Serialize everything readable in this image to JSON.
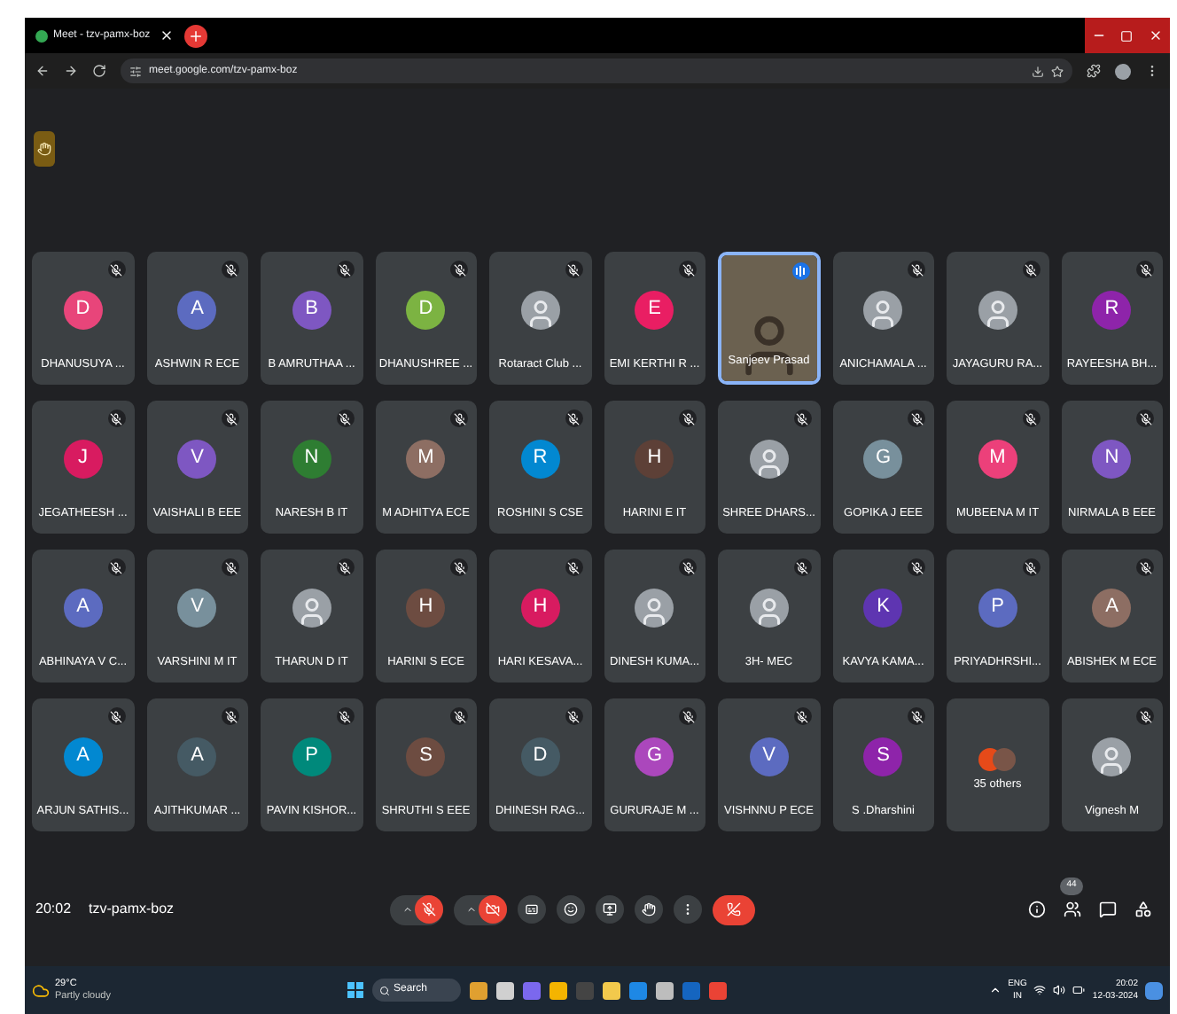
{
  "browser": {
    "tab_title": "Meet - tzv-pamx-boz",
    "url": "meet.google.com/tzv-pamx-boz"
  },
  "participants": [
    {
      "kind": "letter",
      "initial": "D",
      "color": "#e8457a",
      "name": "DHANUSUYA ...",
      "muted": true,
      "speaking": false
    },
    {
      "kind": "letter",
      "initial": "A",
      "color": "#5c6bc0",
      "name": "ASHWIN R ECE",
      "muted": true,
      "speaking": false
    },
    {
      "kind": "letter",
      "initial": "B",
      "color": "#7e57c2",
      "name": "B AMRUTHAA ...",
      "muted": true,
      "speaking": false
    },
    {
      "kind": "letter",
      "initial": "D",
      "color": "#7cb342",
      "name": "DHANUSHREE ...",
      "muted": true,
      "speaking": false
    },
    {
      "kind": "image",
      "name": "Rotaract Club ...",
      "muted": true,
      "speaking": false
    },
    {
      "kind": "letter",
      "initial": "E",
      "color": "#e91e63",
      "name": "EMI KERTHI R ...",
      "muted": true,
      "speaking": false
    },
    {
      "kind": "video",
      "name": "Sanjeev Prasad",
      "muted": false,
      "speaking": true
    },
    {
      "kind": "image",
      "name": "ANICHAMALA ...",
      "muted": true,
      "speaking": false
    },
    {
      "kind": "image",
      "name": "JAYAGURU RA...",
      "muted": true,
      "speaking": false
    },
    {
      "kind": "letter",
      "initial": "R",
      "color": "#8e24aa",
      "name": "RAYEESHA BH...",
      "muted": true,
      "speaking": false
    },
    {
      "kind": "letter",
      "initial": "J",
      "color": "#d81b60",
      "name": "JEGATHEESH ...",
      "muted": true,
      "speaking": false
    },
    {
      "kind": "letter",
      "initial": "V",
      "color": "#7e57c2",
      "name": "VAISHALI B EEE",
      "muted": true,
      "speaking": false
    },
    {
      "kind": "letter",
      "initial": "N",
      "color": "#2e7d32",
      "name": "NARESH B IT",
      "muted": true,
      "speaking": false
    },
    {
      "kind": "letter",
      "initial": "M",
      "color": "#8d6e63",
      "name": "M ADHITYA ECE",
      "muted": true,
      "speaking": false
    },
    {
      "kind": "letter",
      "initial": "R",
      "color": "#0288d1",
      "name": "ROSHINI S CSE",
      "muted": true,
      "speaking": false
    },
    {
      "kind": "letter",
      "initial": "H",
      "color": "#5d4037",
      "name": "HARINI E IT",
      "muted": true,
      "speaking": false
    },
    {
      "kind": "image",
      "name": "SHREE DHARS...",
      "muted": true,
      "speaking": false
    },
    {
      "kind": "letter",
      "initial": "G",
      "color": "#78909c",
      "name": "GOPIKA J EEE",
      "muted": true,
      "speaking": false
    },
    {
      "kind": "letter",
      "initial": "M",
      "color": "#ec407a",
      "name": "MUBEENA M IT",
      "muted": true,
      "speaking": false
    },
    {
      "kind": "letter",
      "initial": "N",
      "color": "#7e57c2",
      "name": "NIRMALA B EEE",
      "muted": true,
      "speaking": false
    },
    {
      "kind": "letter",
      "initial": "A",
      "color": "#5c6bc0",
      "name": "ABHINAYA V C...",
      "muted": true,
      "speaking": false
    },
    {
      "kind": "letter",
      "initial": "V",
      "color": "#78909c",
      "name": "VARSHINI M IT",
      "muted": true,
      "speaking": false
    },
    {
      "kind": "image",
      "name": "THARUN D IT",
      "muted": true,
      "speaking": false
    },
    {
      "kind": "letter",
      "initial": "H",
      "color": "#6d4c41",
      "name": "HARINI S ECE",
      "muted": true,
      "speaking": false
    },
    {
      "kind": "letter",
      "initial": "H",
      "color": "#d81b60",
      "name": "HARI KESAVA...",
      "muted": true,
      "speaking": false
    },
    {
      "kind": "image",
      "name": "DINESH KUMA...",
      "muted": true,
      "speaking": false
    },
    {
      "kind": "image",
      "name": "3H- MEC",
      "muted": true,
      "speaking": false
    },
    {
      "kind": "letter",
      "initial": "K",
      "color": "#5e35b1",
      "name": "KAVYA KAMA...",
      "muted": true,
      "speaking": false
    },
    {
      "kind": "letter",
      "initial": "P",
      "color": "#5c6bc0",
      "name": "PRIYADHRSHI...",
      "muted": true,
      "speaking": false
    },
    {
      "kind": "letter",
      "initial": "A",
      "color": "#8d6e63",
      "name": "ABISHEK M ECE",
      "muted": true,
      "speaking": false
    },
    {
      "kind": "letter",
      "initial": "A",
      "color": "#0288d1",
      "name": "ARJUN SATHIS...",
      "muted": true,
      "speaking": false
    },
    {
      "kind": "letter",
      "initial": "A",
      "color": "#455a64",
      "name": "AJITHKUMAR ...",
      "muted": true,
      "speaking": false
    },
    {
      "kind": "letter",
      "initial": "P",
      "color": "#00897b",
      "name": "PAVIN KISHOR...",
      "muted": true,
      "speaking": false
    },
    {
      "kind": "letter",
      "initial": "S",
      "color": "#6d4c41",
      "name": "SHRUTHI S EEE",
      "muted": true,
      "speaking": false
    },
    {
      "kind": "letter",
      "initial": "D",
      "color": "#455a64",
      "name": "DHINESH RAG...",
      "muted": true,
      "speaking": false
    },
    {
      "kind": "letter",
      "initial": "G",
      "color": "#ab47bc",
      "name": "GURURAJE M ...",
      "muted": true,
      "speaking": false
    },
    {
      "kind": "letter",
      "initial": "V",
      "color": "#5c6bc0",
      "name": "VISHNNU P ECE",
      "muted": true,
      "speaking": false
    },
    {
      "kind": "letter",
      "initial": "S",
      "color": "#8e24aa",
      "name": "S .Dharshini",
      "muted": true,
      "speaking": false
    },
    {
      "kind": "others",
      "name": "35 others",
      "muted": false,
      "speaking": false
    },
    {
      "kind": "image",
      "name": "Vignesh M",
      "muted": true,
      "speaking": false
    }
  ],
  "meeting": {
    "time": "20:02",
    "code": "tzv-pamx-boz",
    "participant_count": "44"
  },
  "taskbar": {
    "temperature": "29°C",
    "weather": "Partly cloudy",
    "search": "Search",
    "language": "ENG",
    "region": "IN",
    "time": "20:02",
    "date": "12-03-2024"
  }
}
